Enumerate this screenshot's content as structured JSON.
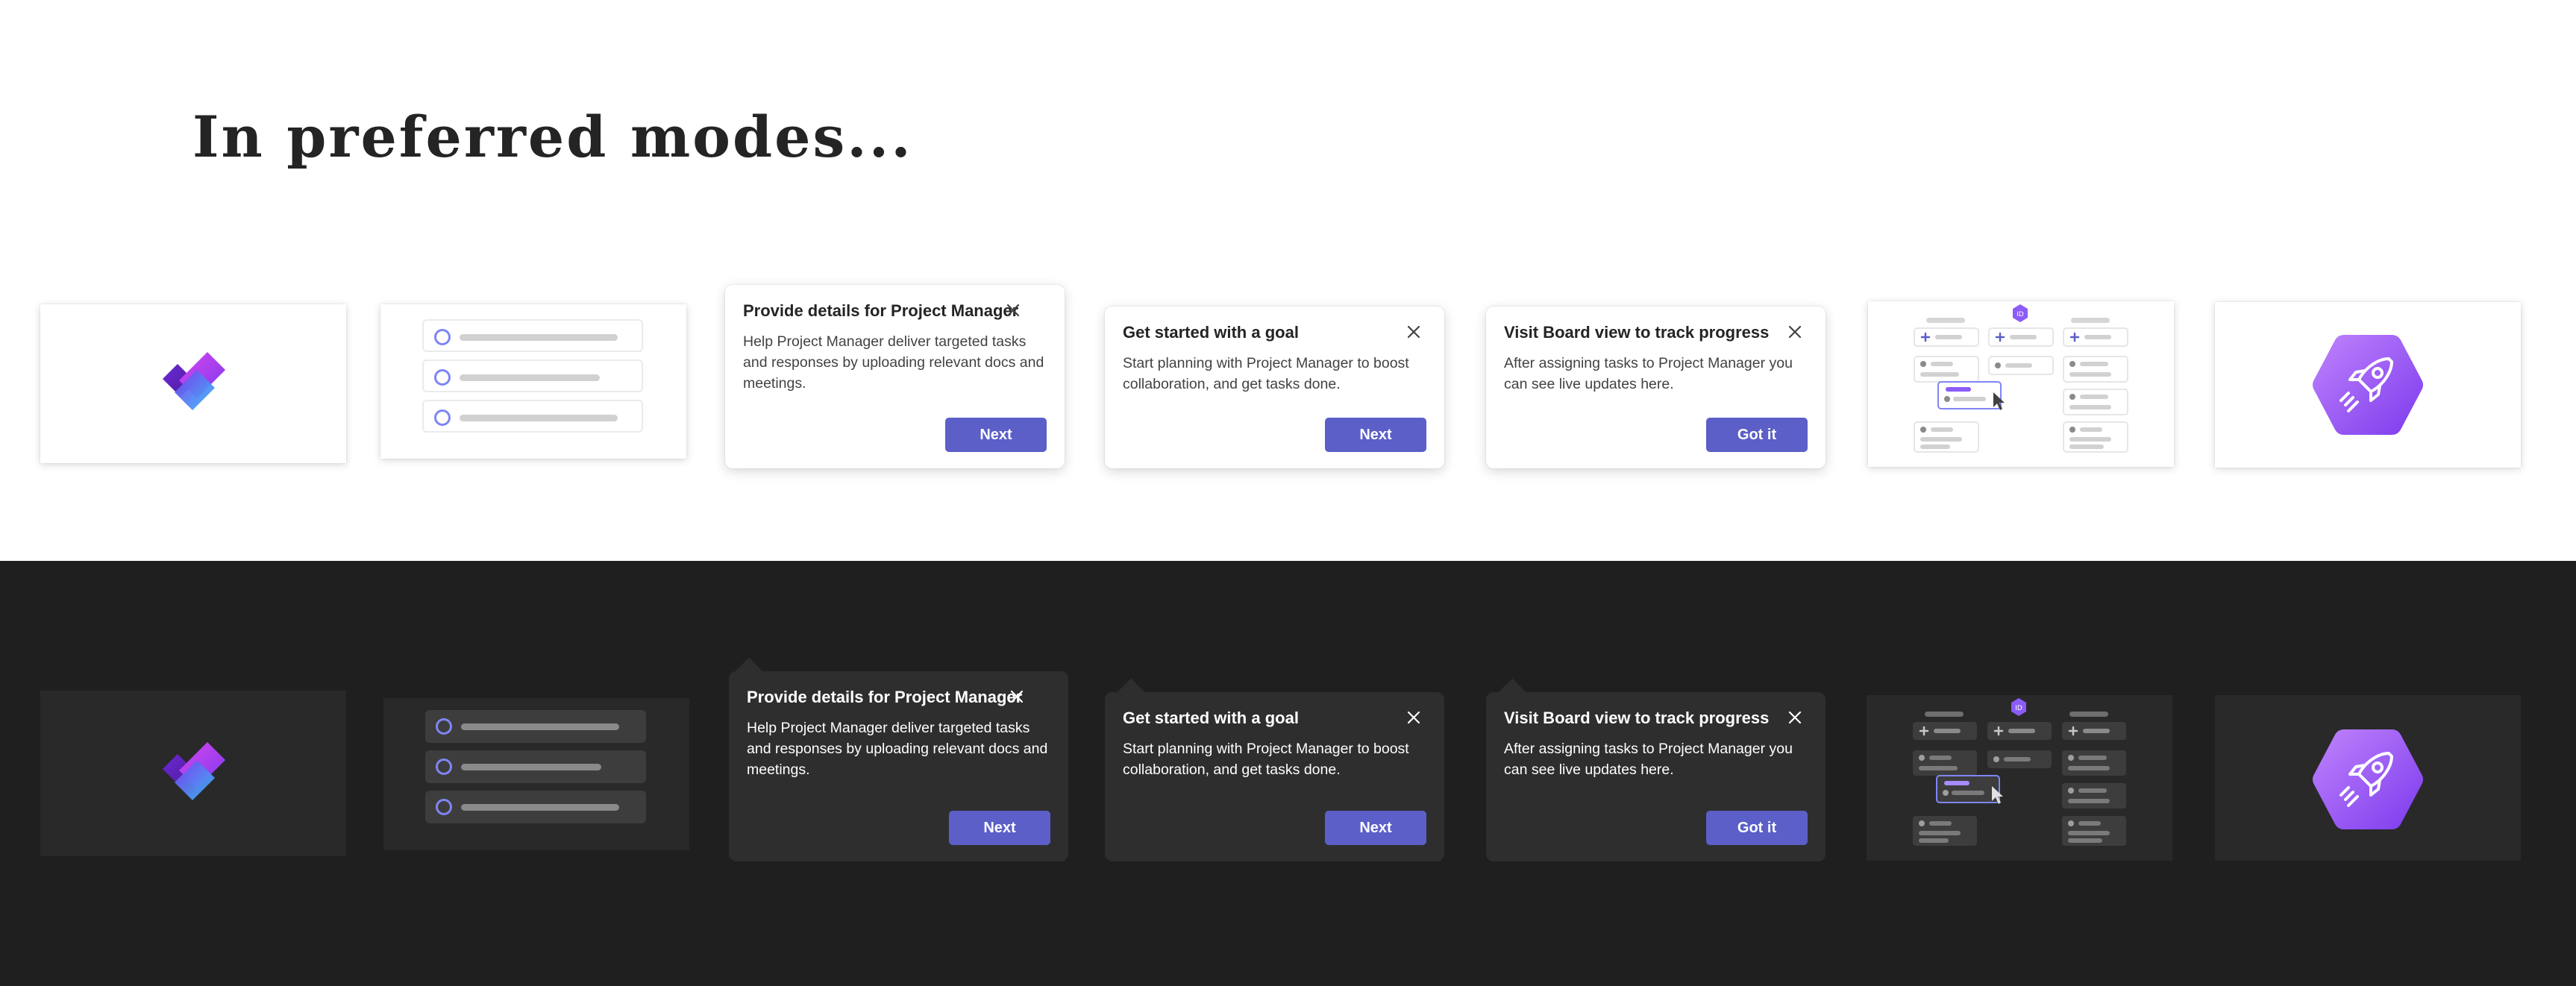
{
  "heading": "In preferred modes...",
  "colors": {
    "light_background": "#ffffff",
    "dark_background": "#1f1f1f",
    "accent": "#5b5fc7",
    "brand_purple": "#8b5cf6"
  },
  "icons": {
    "app_logo": "project-manager-logo-icon",
    "board": "board-illustration-icon",
    "rocket": "rocket-hexagon-icon",
    "close": "close-icon"
  },
  "popups": [
    {
      "title": "Provide details for Project Manager",
      "body": "Help Project Manager deliver targeted tasks and responses by uploading relevant docs and meetings.",
      "button": "Next"
    },
    {
      "title": "Get started with a goal",
      "body": "Start planning with Project Manager to boost collaboration, and get tasks done.",
      "button": "Next"
    },
    {
      "title": "Visit Board view to track progress",
      "body": "After assigning tasks to Project Manager you can see live updates here.",
      "button": "Got it"
    }
  ]
}
